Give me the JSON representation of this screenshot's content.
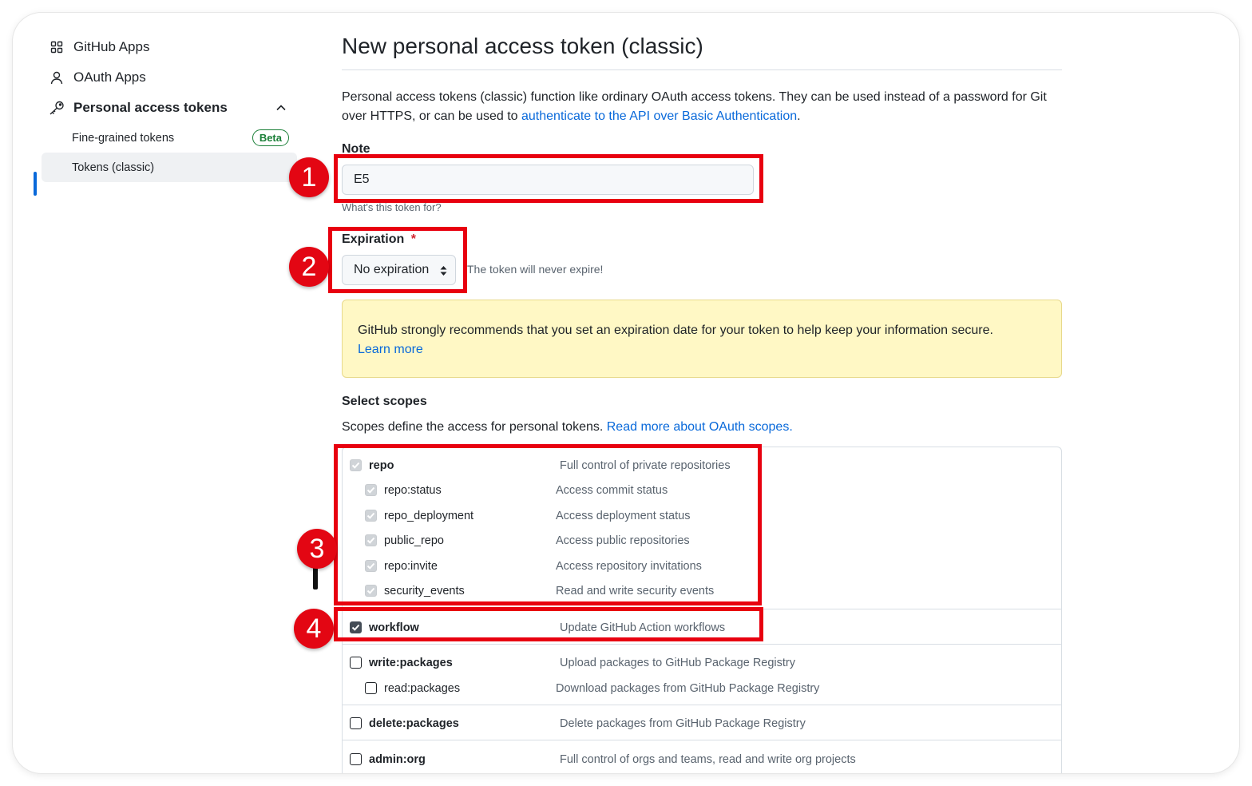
{
  "sidebar": {
    "items": [
      {
        "label": "GitHub Apps",
        "icon": "apps-grid-icon"
      },
      {
        "label": "OAuth Apps",
        "icon": "person-icon"
      },
      {
        "label": "Personal access tokens",
        "icon": "key-icon"
      }
    ],
    "sub_items": [
      {
        "label": "Fine-grained tokens",
        "badge": "Beta"
      },
      {
        "label": "Tokens (classic)"
      }
    ]
  },
  "page": {
    "title": "New personal access token (classic)",
    "intro_text": "Personal access tokens (classic) function like ordinary OAuth access tokens. They can be used instead of a password for Git over HTTPS, or can be used to ",
    "intro_link": "authenticate to the API over Basic Authentication",
    "intro_end": "."
  },
  "note": {
    "label": "Note",
    "value": "E5",
    "hint": "What's this token for?"
  },
  "expiration": {
    "label": "Expiration",
    "required_mark": "*",
    "selected": "No expiration",
    "hint": "The token will never expire!"
  },
  "flash": {
    "text": "GitHub strongly recommends that you set an expiration date for your token to help keep your information secure.",
    "link": "Learn more"
  },
  "scopes": {
    "heading": "Select scopes",
    "intro": "Scopes define the access for personal tokens. ",
    "intro_link": "Read more about OAuth scopes.",
    "rows": [
      {
        "name": "repo",
        "desc": "Full control of private repositories",
        "checked": true,
        "disabled": true
      },
      {
        "name": "repo:status",
        "desc": "Access commit status",
        "checked": true,
        "disabled": true
      },
      {
        "name": "repo_deployment",
        "desc": "Access deployment status",
        "checked": true,
        "disabled": true
      },
      {
        "name": "public_repo",
        "desc": "Access public repositories",
        "checked": true,
        "disabled": true
      },
      {
        "name": "repo:invite",
        "desc": "Access repository invitations",
        "checked": true,
        "disabled": true
      },
      {
        "name": "security_events",
        "desc": "Read and write security events",
        "checked": true,
        "disabled": true
      },
      {
        "name": "workflow",
        "desc": "Update GitHub Action workflows",
        "checked": true,
        "disabled": false
      },
      {
        "name": "write:packages",
        "desc": "Upload packages to GitHub Package Registry",
        "checked": false,
        "disabled": false
      },
      {
        "name": "read:packages",
        "desc": "Download packages from GitHub Package Registry",
        "checked": false,
        "disabled": false
      },
      {
        "name": "delete:packages",
        "desc": "Delete packages from GitHub Package Registry",
        "checked": false,
        "disabled": false
      },
      {
        "name": "admin:org",
        "desc": "Full control of orgs and teams, read and write org projects",
        "checked": false,
        "disabled": false
      }
    ]
  },
  "annotations": {
    "markers": [
      "1",
      "2",
      "3",
      "4"
    ],
    "color": "#e30613"
  },
  "colors": {
    "link": "#0969da",
    "flash_bg": "#fff8c5",
    "beta": "#1a7f37"
  }
}
